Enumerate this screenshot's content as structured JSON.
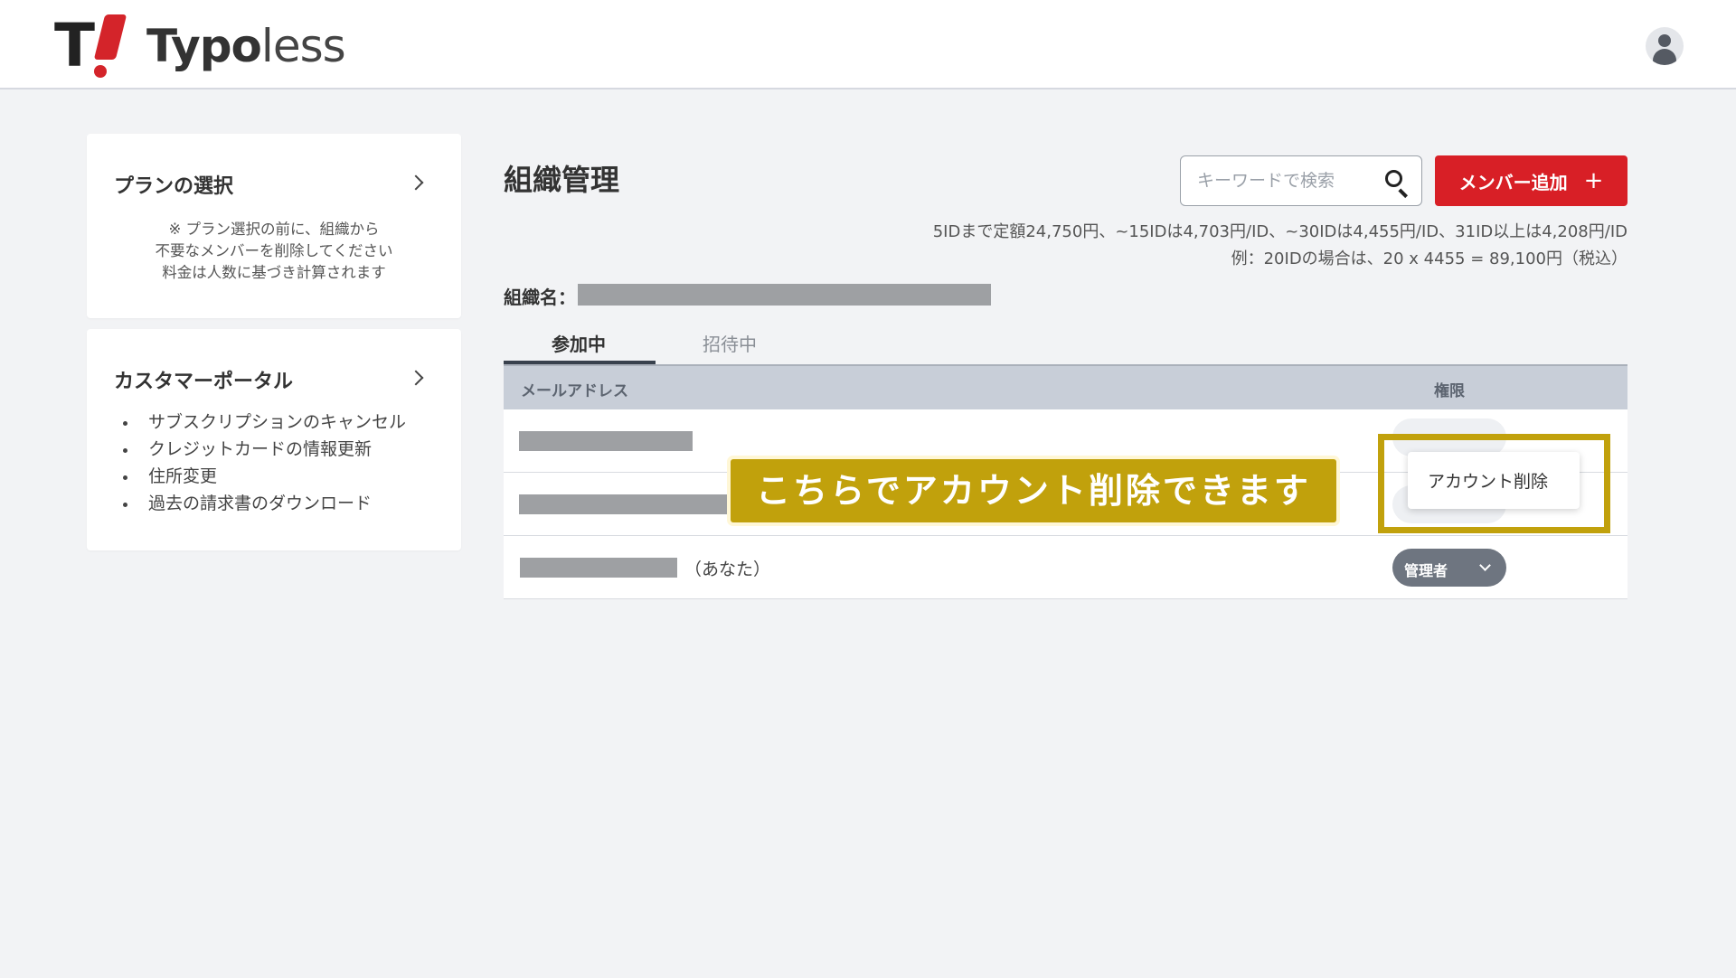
{
  "header": {
    "logo_mark": "T",
    "logo_text_bold": "Typo",
    "logo_text_light": "less",
    "avatar_icon": "user-icon"
  },
  "sidebar": {
    "plan": {
      "title": "プランの選択",
      "note_lines": [
        "※ プラン選択の前に、組織から",
        "不要なメンバーを削除してください",
        "料金は人数に基づき計算されます"
      ]
    },
    "portal": {
      "title": "カスタマーポータル",
      "items": [
        "サブスクリプションのキャンセル",
        "クレジットカードの情報更新",
        "住所変更",
        "過去の請求書のダウンロード"
      ]
    }
  },
  "main": {
    "title": "組織管理",
    "search_placeholder": "キーワードで検索",
    "add_button": "メンバー追加",
    "add_button_icon": "+",
    "price_line1": "5IDまで定額24,750円、~15IDは4,703円/ID、~30IDは4,455円/ID、31ID以上は4,208円/ID",
    "price_line2": "例：20IDの場合は、20 x 4455 = 89,100円（税込）",
    "org_label": "組織名：",
    "tabs": [
      "参加中",
      "招待中"
    ],
    "columns": [
      "メールアドレス",
      "権限"
    ],
    "rows": [
      {
        "you": ""
      },
      {
        "you": ""
      },
      {
        "you": "（あなた）",
        "role": "管理者"
      }
    ],
    "menu_item": "アカウント削除"
  },
  "annotation": {
    "banner": "こちらでアカウント削除できます",
    "accent": "#c1a10c"
  },
  "colors": {
    "brand_red": "#d81f26",
    "background": "#f2f3f5",
    "table_header": "#c8ced8"
  }
}
